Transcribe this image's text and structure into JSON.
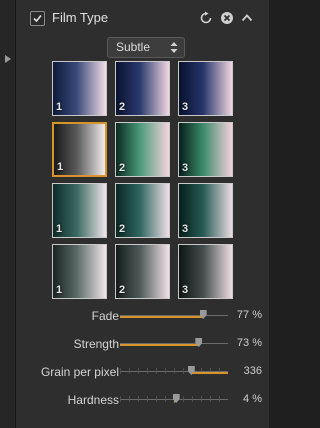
{
  "header": {
    "title": "Film Type",
    "enabled": true,
    "icons": [
      "check-icon",
      "reset-icon",
      "close-icon",
      "chevron-up-icon"
    ]
  },
  "preset_dropdown": {
    "selected": "Subtle"
  },
  "film_tiles": [
    {
      "num": "1",
      "selected": false,
      "gradient": [
        "#0d1a3a",
        "#3a4a7a",
        "#f4dde6"
      ]
    },
    {
      "num": "2",
      "selected": false,
      "gradient": [
        "#0a1230",
        "#2a3a6e",
        "#f2d8e2"
      ]
    },
    {
      "num": "3",
      "selected": false,
      "gradient": [
        "#08122e",
        "#25346a",
        "#f0d6e0"
      ]
    },
    {
      "num": "1",
      "selected": true,
      "gradient": [
        "#1a1a1a",
        "#5a5a5a",
        "#f2ebee"
      ]
    },
    {
      "num": "2",
      "selected": false,
      "gradient": [
        "#0a2a22",
        "#4a9a7a",
        "#f6d4de"
      ]
    },
    {
      "num": "3",
      "selected": false,
      "gradient": [
        "#071e1a",
        "#3a8a6a",
        "#f4d0dc"
      ]
    },
    {
      "num": "1",
      "selected": false,
      "gradient": [
        "#0e2a28",
        "#3a6a62",
        "#f0e4ea"
      ]
    },
    {
      "num": "2",
      "selected": false,
      "gradient": [
        "#0a2624",
        "#2f6660",
        "#eee0e6"
      ]
    },
    {
      "num": "3",
      "selected": false,
      "gradient": [
        "#061e1c",
        "#255a54",
        "#eadce2"
      ]
    },
    {
      "num": "1",
      "selected": false,
      "gradient": [
        "#1a2422",
        "#5a6a66",
        "#f3e6ea"
      ]
    },
    {
      "num": "2",
      "selected": false,
      "gradient": [
        "#141c1a",
        "#4e5a58",
        "#f1e2e8"
      ]
    },
    {
      "num": "3",
      "selected": false,
      "gradient": [
        "#0e1614",
        "#424c4a",
        "#eedee4"
      ]
    }
  ],
  "sliders": [
    {
      "label": "Fade",
      "value": "77 %",
      "level": 0.77,
      "centered": false,
      "ticks": false
    },
    {
      "label": "Strength",
      "value": "73 %",
      "level": 0.73,
      "centered": false,
      "ticks": false
    },
    {
      "label": "Grain per pixel",
      "value": "336",
      "level": 0.66,
      "centered": false,
      "ticks": true
    },
    {
      "label": "Hardness",
      "value": "4 %",
      "level": 0.52,
      "centered": true,
      "ticks": true
    }
  ],
  "colors": {
    "accent": "#d8942a",
    "panel": "#2e2e2e",
    "background": "#1f1f1f"
  }
}
